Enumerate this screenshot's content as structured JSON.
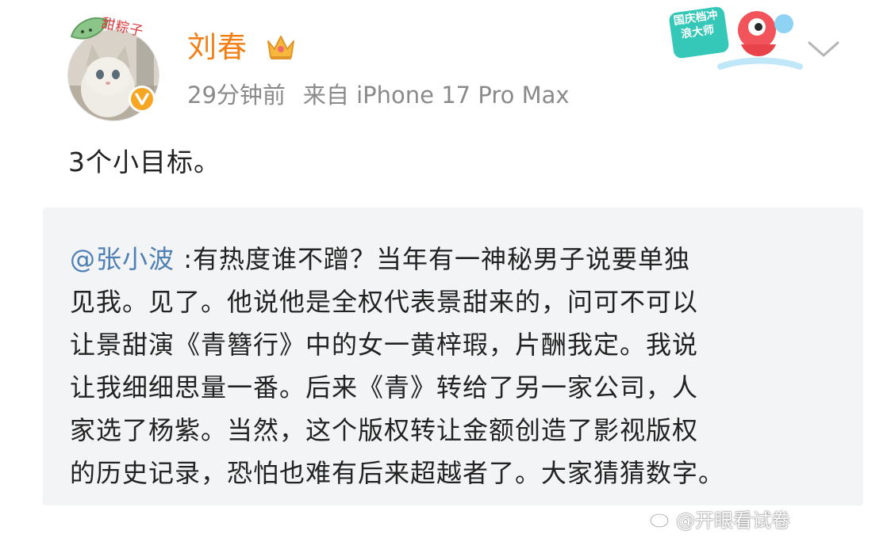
{
  "user": {
    "name": "刘春",
    "avatar_sticker_text": "甜粽子",
    "verified_icon": "verified-badge-icon",
    "crown_icon": "crown-icon"
  },
  "meta": {
    "time": "29分钟前",
    "source": "来自 iPhone 17 Pro Max"
  },
  "promo": {
    "label": "国庆档冲浪大师"
  },
  "post": {
    "text": "3个小目标。"
  },
  "repost": {
    "mention": "@张小波",
    "text": " :有热度谁不蹭？当年有一神秘男子说要单独\n见我。见了。他说他是全权代表景甜来的，问可不可以\n让景甜演《青簪行》中的女一黄梓瑕，片酬我定。我说\n让我细细思量一番。后来《青》转给了另一家公司，人\n家选了杨紫。当然，这个版权转让金额创造了影视版权\n的历史记录，恐怕也难有后来超越者了。大家猜猜数字。"
  },
  "watermark": {
    "text": "@开眼看试卷"
  },
  "colors": {
    "username": "#f37e14",
    "meta": "#8a8a8a",
    "mention": "#4e7fb5",
    "card_bg": "#f3f4f5",
    "verified": "#f6a623"
  }
}
